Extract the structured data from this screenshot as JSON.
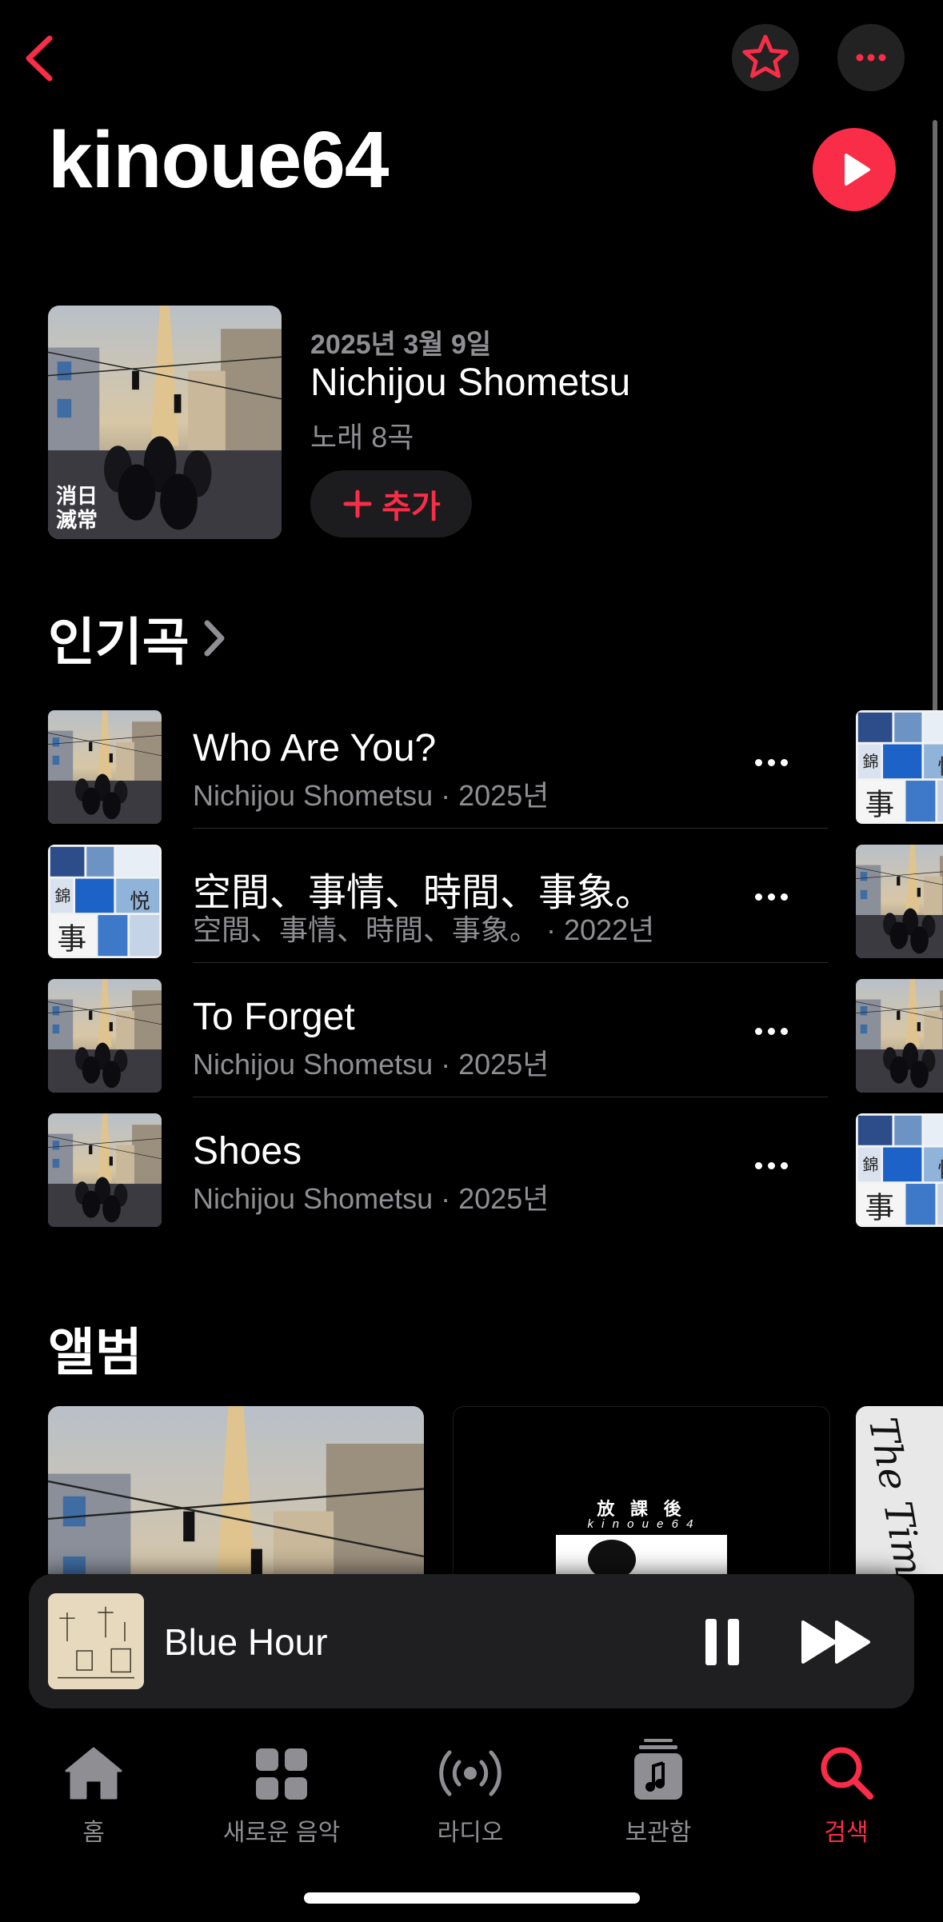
{
  "artist": {
    "name": "kinoue64"
  },
  "colors": {
    "accent": "#fa2d48",
    "secondary_text": "#8e8e93",
    "background": "#000000"
  },
  "icons": {
    "back": "chevron-left-icon",
    "favorite": "star-icon",
    "more": "ellipsis-icon",
    "play": "play-icon"
  },
  "latest_release": {
    "date": "2025년 3월 9일",
    "title": "Nichijou Shometsu",
    "count": "노래 8곡",
    "add_label": "추가",
    "art_text": "消日\n滅常"
  },
  "top_songs": {
    "heading": "인기곡",
    "items": [
      {
        "title": "Who Are You?",
        "subtitle": "Nichijou Shometsu · 2025년"
      },
      {
        "title": "空間、事情、時間、事象。",
        "subtitle": "空間、事情、時間、事象。 · 2022년"
      },
      {
        "title": "To Forget",
        "subtitle": "Nichijou Shometsu · 2025년"
      },
      {
        "title": "Shoes",
        "subtitle": "Nichijou Shometsu · 2025년"
      }
    ]
  },
  "albums": {
    "heading": "앨범",
    "second_album_text": {
      "title": "放 課 後",
      "artist": "k i n o u e 6 4"
    },
    "third_album_text": "The Time"
  },
  "now_playing": {
    "title": "Blue Hour"
  },
  "tabs": [
    {
      "label": "홈",
      "icon": "home-icon"
    },
    {
      "label": "새로운 음악",
      "icon": "grid-icon"
    },
    {
      "label": "라디오",
      "icon": "radio-icon"
    },
    {
      "label": "보관함",
      "icon": "library-icon"
    },
    {
      "label": "검색",
      "icon": "search-icon",
      "active": true
    }
  ]
}
